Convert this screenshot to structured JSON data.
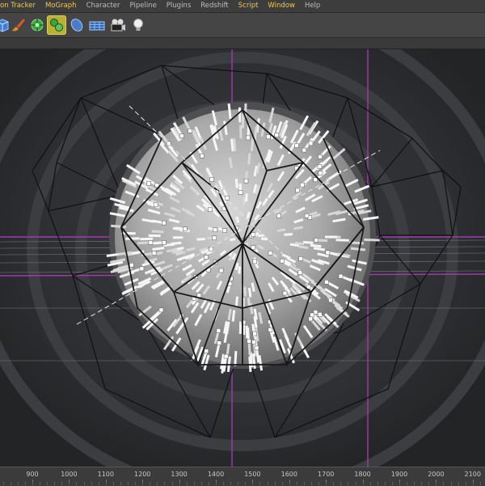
{
  "menubar": {
    "items": [
      {
        "label": "on Tracker",
        "highlight": true
      },
      {
        "label": "MoGraph",
        "highlight": true
      },
      {
        "label": "Character",
        "highlight": false
      },
      {
        "label": "Pipeline",
        "highlight": false
      },
      {
        "label": "Plugins",
        "highlight": false
      },
      {
        "label": "Redshift",
        "highlight": false
      },
      {
        "label": "Script",
        "highlight": true
      },
      {
        "label": "Window",
        "highlight": true
      },
      {
        "label": "Help",
        "highlight": false
      }
    ]
  },
  "toolbar": {
    "icons": [
      {
        "name": "cube-icon",
        "active": false
      },
      {
        "name": "brush-icon",
        "active": false
      },
      {
        "name": "deformer-icon",
        "active": false
      },
      {
        "name": "cloner-icon",
        "active": true
      },
      {
        "name": "generator-icon",
        "active": false
      },
      {
        "name": "floor-grid-icon",
        "active": false
      },
      {
        "name": "camera-icon",
        "active": false
      },
      {
        "name": "light-bulb-icon",
        "active": false
      }
    ]
  },
  "timeline": {
    "labels": [
      "900",
      "1000",
      "1100",
      "1200",
      "1300",
      "1400",
      "1500",
      "1600",
      "1700",
      "1800",
      "1900",
      "2000",
      "2100"
    ],
    "current": "1500"
  },
  "colors": {
    "accent": "#f2c94c",
    "guide": "#a23bb0",
    "active_icon": "#b9b036"
  }
}
